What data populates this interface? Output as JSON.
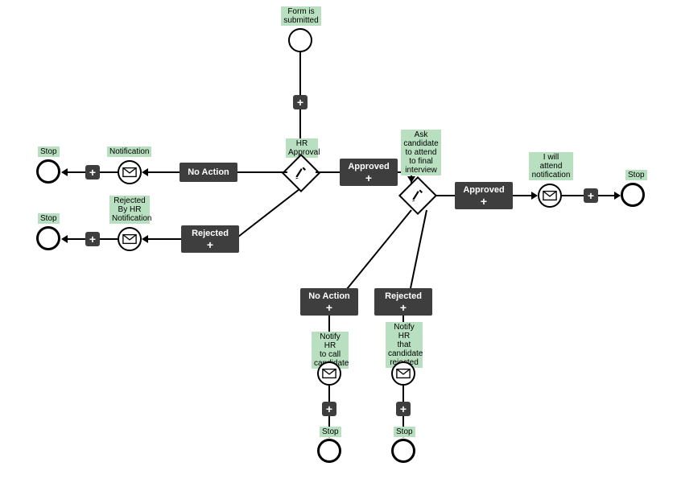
{
  "chart_data": {
    "type": "diagram",
    "title": "",
    "startEvent": {
      "label": "Form is submitted"
    },
    "gateways": [
      {
        "id": "g1",
        "label": "HR Approval"
      },
      {
        "id": "g2",
        "label": "Ask candidate to attend to final interview"
      }
    ],
    "actions": [
      {
        "id": "a1",
        "label": "No Action",
        "from": "g1"
      },
      {
        "id": "a2",
        "label": "Rejected",
        "from": "g1"
      },
      {
        "id": "a3",
        "label": "Approved",
        "from": "g1"
      },
      {
        "id": "a4",
        "label": "No Action",
        "from": "g2"
      },
      {
        "id": "a5",
        "label": "Rejected",
        "from": "g2"
      },
      {
        "id": "a6",
        "label": "Approved",
        "from": "g2"
      }
    ],
    "notifications": [
      {
        "id": "n1",
        "label": "Notification"
      },
      {
        "id": "n2",
        "label": "Rejected By HR Notification"
      },
      {
        "id": "n3",
        "label": "Notify HR to call candidate"
      },
      {
        "id": "n4",
        "label": "Notify HR that candidate rejected"
      },
      {
        "id": "n5",
        "label": "I will attend notification"
      }
    ],
    "endEvents": [
      {
        "id": "e1",
        "label": "Stop"
      },
      {
        "id": "e2",
        "label": "Stop"
      },
      {
        "id": "e3",
        "label": "Stop"
      },
      {
        "id": "e4",
        "label": "Stop"
      },
      {
        "id": "e5",
        "label": "Stop"
      }
    ]
  },
  "labels": {
    "formSubmitted": "Form is\nsubmitted",
    "hrApproval": "HR\nApproval",
    "askCandidate": "Ask\ncandidate\nto attend\nto final\ninterview",
    "notification": "Notification",
    "rejectedByHR": "Rejected\nBy HR\nNotification",
    "notifyCall": "Notify HR\nto call\ncandidate",
    "notifyRejected": "Notify HR\nthat\ncandidate\nrejected",
    "willAttend": "I will\nattend\nnotification",
    "stop": "Stop",
    "noAction": "No Action",
    "rejected": "Rejected",
    "approved": "Approved",
    "plus": "+"
  }
}
